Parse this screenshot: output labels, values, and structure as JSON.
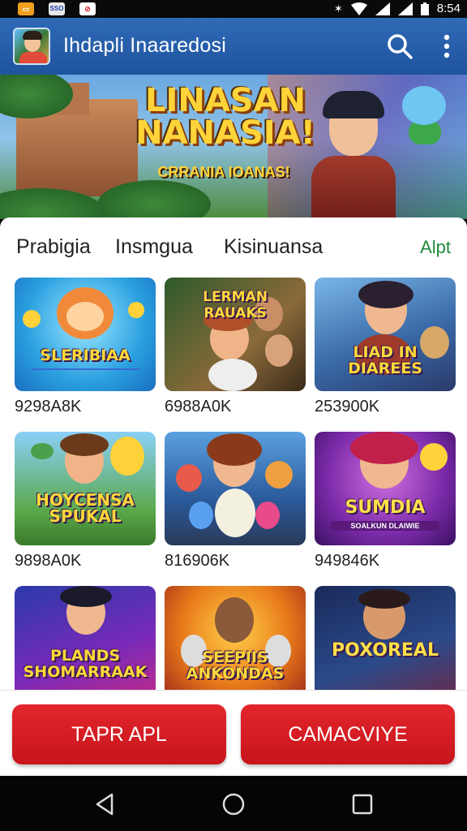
{
  "status_bar": {
    "time": "8:54",
    "icons": [
      "app-notification-icon",
      "sb-app-icon",
      "no-sim-icon",
      "wifi-icon",
      "signal-icon",
      "battery-icon"
    ],
    "sb_app2_text": "SSO"
  },
  "app_bar": {
    "title": "Ihdapli Inaaredosi"
  },
  "hero": {
    "title_line1": "LINASAN",
    "title_line2": "NANASIA!",
    "subtitle": "CRRANIA IOANAS!"
  },
  "tabs": {
    "items": [
      "Prabigia",
      "Insmgua",
      "Kisinuansa"
    ],
    "all_label": "Alpt"
  },
  "games": [
    {
      "title": "SLERIBIAA",
      "subtitle": "",
      "count": "9298A8K"
    },
    {
      "title": "LERMAN RAUAKS",
      "subtitle": "",
      "count": "6988A0K"
    },
    {
      "title": "LIAD IN DIAREES",
      "subtitle": "",
      "count": "253900K"
    },
    {
      "title": "HOYCENSA SPUKAL",
      "subtitle": "",
      "count": "9898A0K"
    },
    {
      "title": "",
      "subtitle": "",
      "count": "816906K"
    },
    {
      "title": "SUMDIA",
      "subtitle": "SOALKUN DLAIWIE",
      "count": "949846K"
    },
    {
      "title": "PLANDS SHOMARRAAK",
      "subtitle": "",
      "count": ""
    },
    {
      "title": "SEEPIIS ANKONDAS",
      "subtitle": "",
      "count": ""
    },
    {
      "title": "POXOREAL",
      "subtitle": "",
      "count": ""
    }
  ],
  "actions": {
    "left_label": "TAPR APL",
    "right_label": "CAMACVIYE"
  },
  "colors": {
    "app_bar": "#2a62ae",
    "action_red": "#d81e24",
    "tab_all_green": "#1e8a3a"
  }
}
